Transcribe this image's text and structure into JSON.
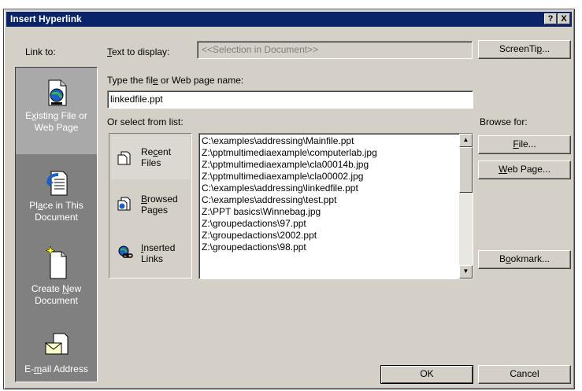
{
  "title": "Insert Hyperlink",
  "title_buttons": {
    "help": "?",
    "close": "X"
  },
  "link_to_label": "Link to:",
  "text_to_display": {
    "label_pre": "",
    "label_accel": "T",
    "label_post": "ext to display:",
    "placeholder": "<<Selection in Document>>"
  },
  "screentip_button": {
    "pre": "ScreenTi",
    "accel": "p",
    "post": "..."
  },
  "file_name": {
    "label_pre": "Type the fil",
    "label_accel": "e",
    "label_post": " or Web page name:",
    "value": "linkedfile.ppt"
  },
  "or_select_label": "Or select from list:",
  "browse_for_label": "Browse for:",
  "link_targets": [
    {
      "pre": "E",
      "accel": "x",
      "post": "isting File or",
      "line2": "Web Page",
      "selected": true,
      "icon": "existing-file-icon"
    },
    {
      "pre": "Pl",
      "accel": "a",
      "post": "ce in This",
      "line2": "Document",
      "selected": false,
      "icon": "place-in-document-icon"
    },
    {
      "pre": "Create ",
      "accel": "N",
      "post": "ew",
      "line2": "Document",
      "selected": false,
      "icon": "create-new-document-icon"
    },
    {
      "pre": "E-",
      "accel": "m",
      "post": "ail Address",
      "line2": "",
      "selected": false,
      "icon": "email-address-icon"
    }
  ],
  "browse_categories": [
    {
      "pre": "Re",
      "accel": "c",
      "post": "ent",
      "line2": "Files",
      "selected": true,
      "icon": "recent-files-icon"
    },
    {
      "pre": "",
      "accel": "B",
      "post": "rowsed",
      "line2": "Pages",
      "selected": false,
      "icon": "browsed-pages-icon"
    },
    {
      "pre": "",
      "accel": "I",
      "post": "nserted",
      "line2": "Links",
      "selected": false,
      "icon": "inserted-links-icon"
    }
  ],
  "files": [
    "C:\\examples\\addressing\\Mainfile.ppt",
    "Z:\\pptmultimediaexample\\computerlab.jpg",
    "Z:\\pptmultimediaexample\\cla00014b.jpg",
    "Z:\\pptmultimediaexample\\cla00002.jpg",
    "C:\\examples\\addressing\\linkedfile.ppt",
    "C:\\examples\\addressing\\test.ppt",
    "Z:\\PPT basics\\Winnebag.jpg",
    "Z:\\groupedactions\\97.ppt",
    "Z:\\groupedactions\\2002.ppt",
    "Z:\\groupedactions\\98.ppt"
  ],
  "buttons": {
    "file": {
      "pre": "",
      "accel": "F",
      "post": "ile..."
    },
    "web_page": {
      "pre": "",
      "accel": "W",
      "post": "eb Page..."
    },
    "bookmark": {
      "pre": "B",
      "accel": "o",
      "post": "okmark..."
    },
    "ok": "OK",
    "cancel": "Cancel"
  }
}
